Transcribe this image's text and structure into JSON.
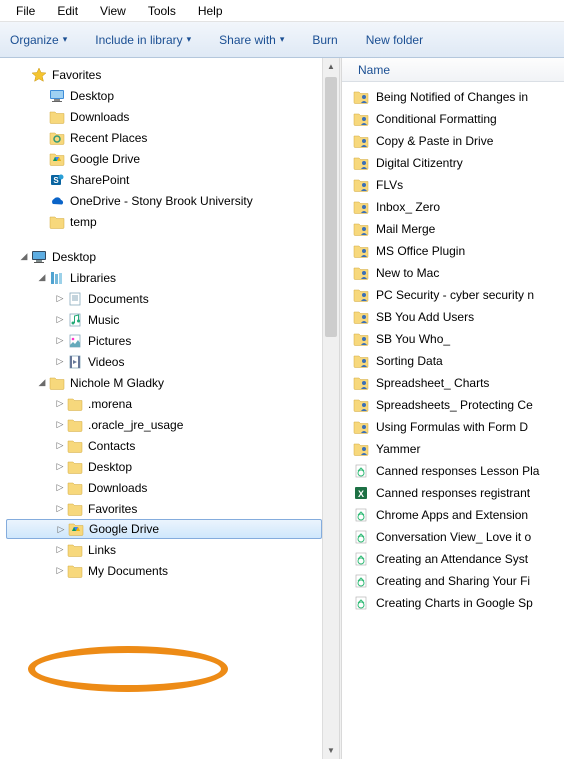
{
  "menubar": [
    "File",
    "Edit",
    "View",
    "Tools",
    "Help"
  ],
  "toolbar": {
    "organize": "Organize",
    "include": "Include in library",
    "share": "Share with",
    "burn": "Burn",
    "newfolder": "New folder"
  },
  "nav": {
    "favorites": {
      "label": "Favorites",
      "items": [
        {
          "icon": "desktop",
          "label": "Desktop"
        },
        {
          "icon": "folder",
          "label": "Downloads"
        },
        {
          "icon": "places",
          "label": "Recent Places"
        },
        {
          "icon": "gdrive",
          "label": "Google Drive"
        },
        {
          "icon": "sharepoint",
          "label": "SharePoint"
        },
        {
          "icon": "onedrive",
          "label": "OneDrive - Stony Brook University"
        },
        {
          "icon": "folder",
          "label": "temp"
        }
      ]
    },
    "desktop": {
      "label": "Desktop",
      "libraries": {
        "label": "Libraries",
        "items": [
          {
            "icon": "doclib",
            "label": "Documents"
          },
          {
            "icon": "musiclib",
            "label": "Music"
          },
          {
            "icon": "piclib",
            "label": "Pictures"
          },
          {
            "icon": "vidlib",
            "label": "Videos"
          }
        ]
      },
      "user": {
        "label": "Nichole M Gladky",
        "items": [
          {
            "icon": "folder",
            "label": ".morena"
          },
          {
            "icon": "folder",
            "label": ".oracle_jre_usage"
          },
          {
            "icon": "folder",
            "label": "Contacts"
          },
          {
            "icon": "folder",
            "label": "Desktop"
          },
          {
            "icon": "folder",
            "label": "Downloads"
          },
          {
            "icon": "folder",
            "label": "Favorites",
            "obscured": true
          },
          {
            "icon": "gdrive",
            "label": "Google Drive",
            "selected": true
          },
          {
            "icon": "folder",
            "label": "Links",
            "obscured": true
          },
          {
            "icon": "folder",
            "label": "My Documents"
          }
        ]
      }
    }
  },
  "content": {
    "column_header": "Name",
    "files": [
      {
        "t": "fp",
        "n": "Being Notified of Changes in"
      },
      {
        "t": "fp",
        "n": "Conditional Formatting"
      },
      {
        "t": "fp",
        "n": "Copy & Paste in Drive"
      },
      {
        "t": "fp",
        "n": "Digital Citizentry"
      },
      {
        "t": "fp",
        "n": "FLVs"
      },
      {
        "t": "fp",
        "n": "Inbox_ Zero"
      },
      {
        "t": "fp",
        "n": "Mail Merge"
      },
      {
        "t": "fp",
        "n": "MS Office Plugin"
      },
      {
        "t": "fp",
        "n": "New to Mac"
      },
      {
        "t": "fp",
        "n": "PC Security - cyber security n"
      },
      {
        "t": "fp",
        "n": "SB You Add Users"
      },
      {
        "t": "fp",
        "n": "SB You Who_"
      },
      {
        "t": "fp",
        "n": "Sorting Data"
      },
      {
        "t": "fp",
        "n": "Spreadsheet_ Charts"
      },
      {
        "t": "fp",
        "n": "Spreadsheets_ Protecting Ce"
      },
      {
        "t": "fp",
        "n": "Using Formulas with Form D"
      },
      {
        "t": "fp",
        "n": "Yammer"
      },
      {
        "t": "wf",
        "n": "Canned responses Lesson Pla"
      },
      {
        "t": "xl",
        "n": "Canned responses registrant"
      },
      {
        "t": "wf",
        "n": "Chrome Apps and Extension"
      },
      {
        "t": "wf",
        "n": "Conversation View_ Love it o"
      },
      {
        "t": "wf",
        "n": "Creating an Attendance Syst"
      },
      {
        "t": "wf",
        "n": "Creating and Sharing Your Fi"
      },
      {
        "t": "wf",
        "n": "Creating Charts in Google Sp"
      }
    ]
  }
}
